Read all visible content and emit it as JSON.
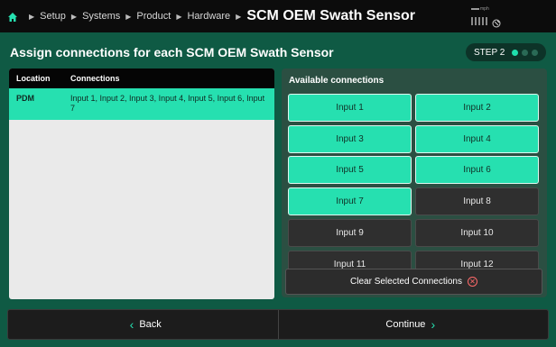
{
  "breadcrumb": {
    "items": [
      "Setup",
      "Systems",
      "Product",
      "Hardware"
    ],
    "title": "SCM OEM Swath Sensor"
  },
  "status": {
    "speed_unit": "mph"
  },
  "heading": "Assign connections for each SCM OEM Swath Sensor",
  "step": {
    "label": "STEP 2",
    "total": 3,
    "current": 1
  },
  "table": {
    "columns": [
      "Location",
      "Connections"
    ],
    "rows": [
      {
        "location": "PDM",
        "connections": "Input 1, Input 2, Input 3, Input 4, Input 5, Input 6, Input 7"
      }
    ]
  },
  "available": {
    "title": "Available connections",
    "buttons": [
      {
        "label": "Input 1",
        "selected": true
      },
      {
        "label": "Input 2",
        "selected": true
      },
      {
        "label": "Input 3",
        "selected": true
      },
      {
        "label": "Input 4",
        "selected": true
      },
      {
        "label": "Input 5",
        "selected": true
      },
      {
        "label": "Input 6",
        "selected": true
      },
      {
        "label": "Input 7",
        "selected": true
      },
      {
        "label": "Input 8",
        "selected": false
      },
      {
        "label": "Input 9",
        "selected": false
      },
      {
        "label": "Input 10",
        "selected": false
      },
      {
        "label": "Input 11",
        "selected": false
      },
      {
        "label": "Input 12",
        "selected": false
      }
    ],
    "clear_label": "Clear Selected Connections"
  },
  "nav": {
    "back_label": "Back",
    "continue_label": "Continue"
  },
  "colors": {
    "accent": "#26e0b0",
    "background": "#0f5a44",
    "topbar": "#0c0c0c"
  }
}
